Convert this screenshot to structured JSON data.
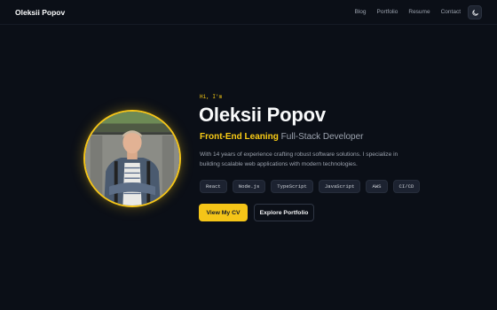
{
  "header": {
    "brand": "Oleksii Popov",
    "nav": [
      "Blog",
      "Portfolio",
      "Resume",
      "Contact"
    ],
    "theme_toggle_icon": "moon-icon"
  },
  "hero": {
    "greeting": "Hi, I'm",
    "name": "Oleksii Popov",
    "role_highlight": "Front-End Leaning",
    "role_rest": "Full-Stack Developer",
    "description": "With 14 years of experience crafting robust software solutions. I specialize in building scalable web applications with modern technologies.",
    "tags": [
      "React",
      "Node.js",
      "TypeScript",
      "JavaScript",
      "AWS",
      "CI/CD"
    ],
    "primary_button": "View My CV",
    "secondary_button": "Explore Portfolio"
  },
  "colors": {
    "background": "#0b0f17",
    "accent": "#facc15",
    "muted_text": "#9ca3af"
  }
}
